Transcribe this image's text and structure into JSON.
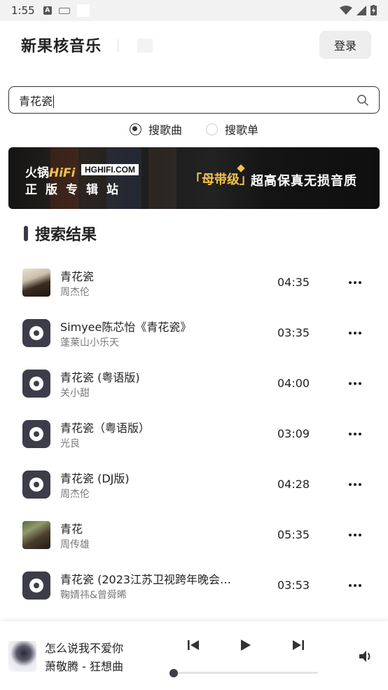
{
  "status_bar": {
    "time": "1:55"
  },
  "header": {
    "app_title": "新果核音乐",
    "login_label": "登录"
  },
  "search": {
    "query": "青花瓷",
    "modes": [
      {
        "label": "搜歌曲",
        "selected": true
      },
      {
        "label": "搜歌单",
        "selected": false
      }
    ]
  },
  "banner": {
    "brand": "火锅",
    "brand_hifi": "HiFi",
    "domain": "HGHIFI.COM",
    "subtitle": "正版专辑站",
    "badge": "「母带级」",
    "slogan": "超高保真无损音质"
  },
  "results": {
    "title": "搜索结果",
    "songs": [
      {
        "title": "青花瓷",
        "artist": "周杰伦",
        "duration": "04:35",
        "thumb": "photo"
      },
      {
        "title": "Simyee陈芯怡《青花瓷》",
        "artist": "蓬莱山小乐天",
        "duration": "03:35",
        "thumb": "disc"
      },
      {
        "title": "青花瓷 (粤语版)",
        "artist": "关小甜",
        "duration": "04:00",
        "thumb": "disc"
      },
      {
        "title": "青花瓷（粤语版）",
        "artist": "光良",
        "duration": "03:09",
        "thumb": "disc"
      },
      {
        "title": "青花瓷 (DJ版)",
        "artist": "周杰伦",
        "duration": "04:28",
        "thumb": "disc"
      },
      {
        "title": "青花",
        "artist": "周传雄",
        "duration": "05:35",
        "thumb": "photo"
      },
      {
        "title": "青花瓷 (2023江苏卫视跨年晚会…",
        "artist": "鞠婧祎&曾舜晞",
        "duration": "03:53",
        "thumb": "disc"
      }
    ]
  },
  "player": {
    "title": "怎么说我不爱你",
    "subtitle": "萧敬腾 - 狂想曲",
    "progress": 0.0
  },
  "colors": {
    "accent": "#3d3d4a",
    "banner_gold": "#f2c14e"
  },
  "icons": [
    "search-icon",
    "disc-icon",
    "more-icon",
    "previous-icon",
    "play-icon",
    "next-icon",
    "volume-icon"
  ]
}
